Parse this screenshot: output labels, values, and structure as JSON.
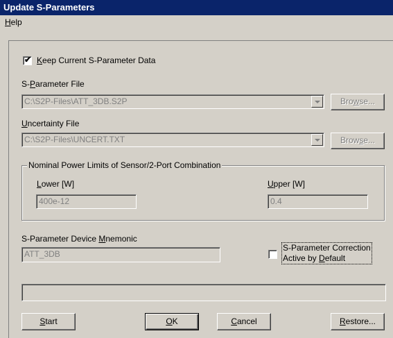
{
  "window": {
    "title": "Update S-Parameters"
  },
  "menu": {
    "help_label": "Help"
  },
  "keep_current": {
    "label": "Keep Current S-Parameter Data",
    "checked": true
  },
  "s_param_file": {
    "label": "S-Parameter File",
    "value": "C:\\S2P-Files\\ATT_3DB.S2P",
    "browse_label": "Browse..."
  },
  "uncertainty_file": {
    "label": "Uncertainty File",
    "value": "C:\\S2P-Files\\UNCERT.TXT",
    "browse_label": "Browse..."
  },
  "power_limits": {
    "legend": "Nominal Power Limits of Sensor/2-Port Combination",
    "lower_label": "Lower [W]",
    "lower_value": "400e-12",
    "upper_label": "Upper [W]",
    "upper_value": "0.4"
  },
  "mnemonic": {
    "label": "S-Parameter Device Mnemonic",
    "value": "ATT_3DB"
  },
  "correction": {
    "label_line1": "S-Parameter Correction",
    "label_line2": "Active by Default",
    "checked": false
  },
  "status_bar": {
    "text": ""
  },
  "buttons": {
    "start": "Start",
    "ok": "OK",
    "cancel": "Cancel",
    "restore": "Restore..."
  }
}
